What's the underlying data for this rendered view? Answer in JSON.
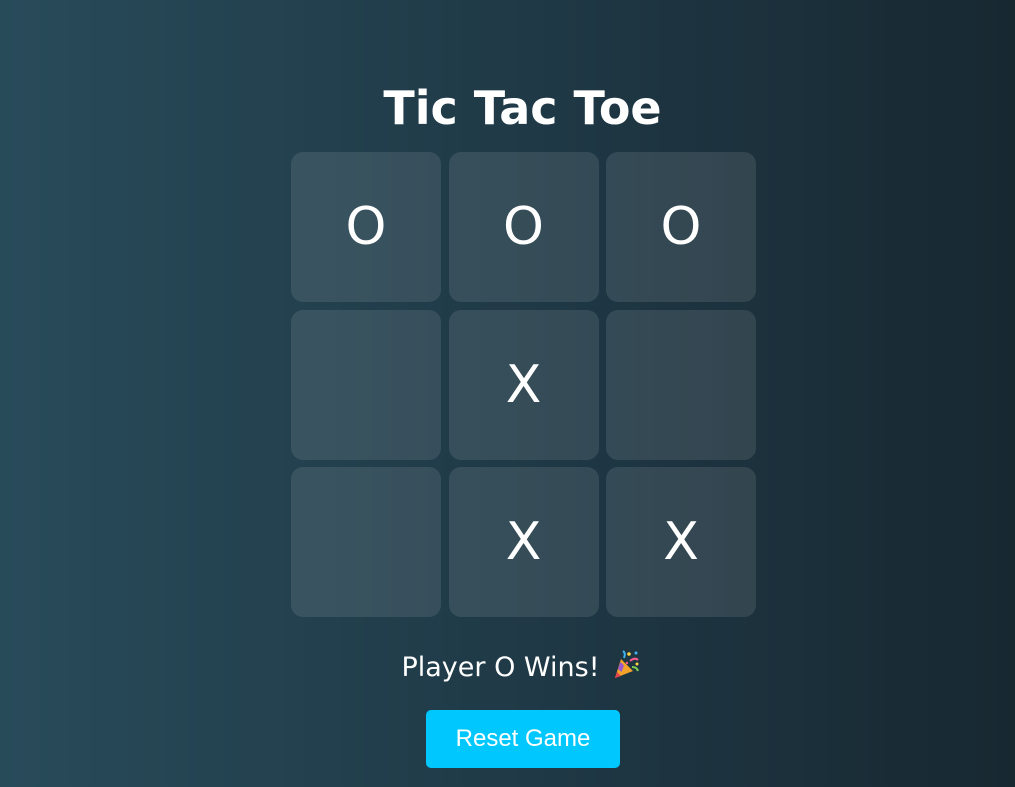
{
  "game": {
    "title": "Tic Tac Toe",
    "board": {
      "cells": [
        "O",
        "O",
        "O",
        "",
        "X",
        "",
        "",
        "X",
        "X"
      ]
    },
    "status": "Player O Wins!",
    "status_icon": "party-popper-icon",
    "reset_label": "Reset Game"
  },
  "colors": {
    "accent": "#00c8ff",
    "background_start": "#284b5a",
    "background_end": "#172831",
    "text": "#ffffff"
  }
}
